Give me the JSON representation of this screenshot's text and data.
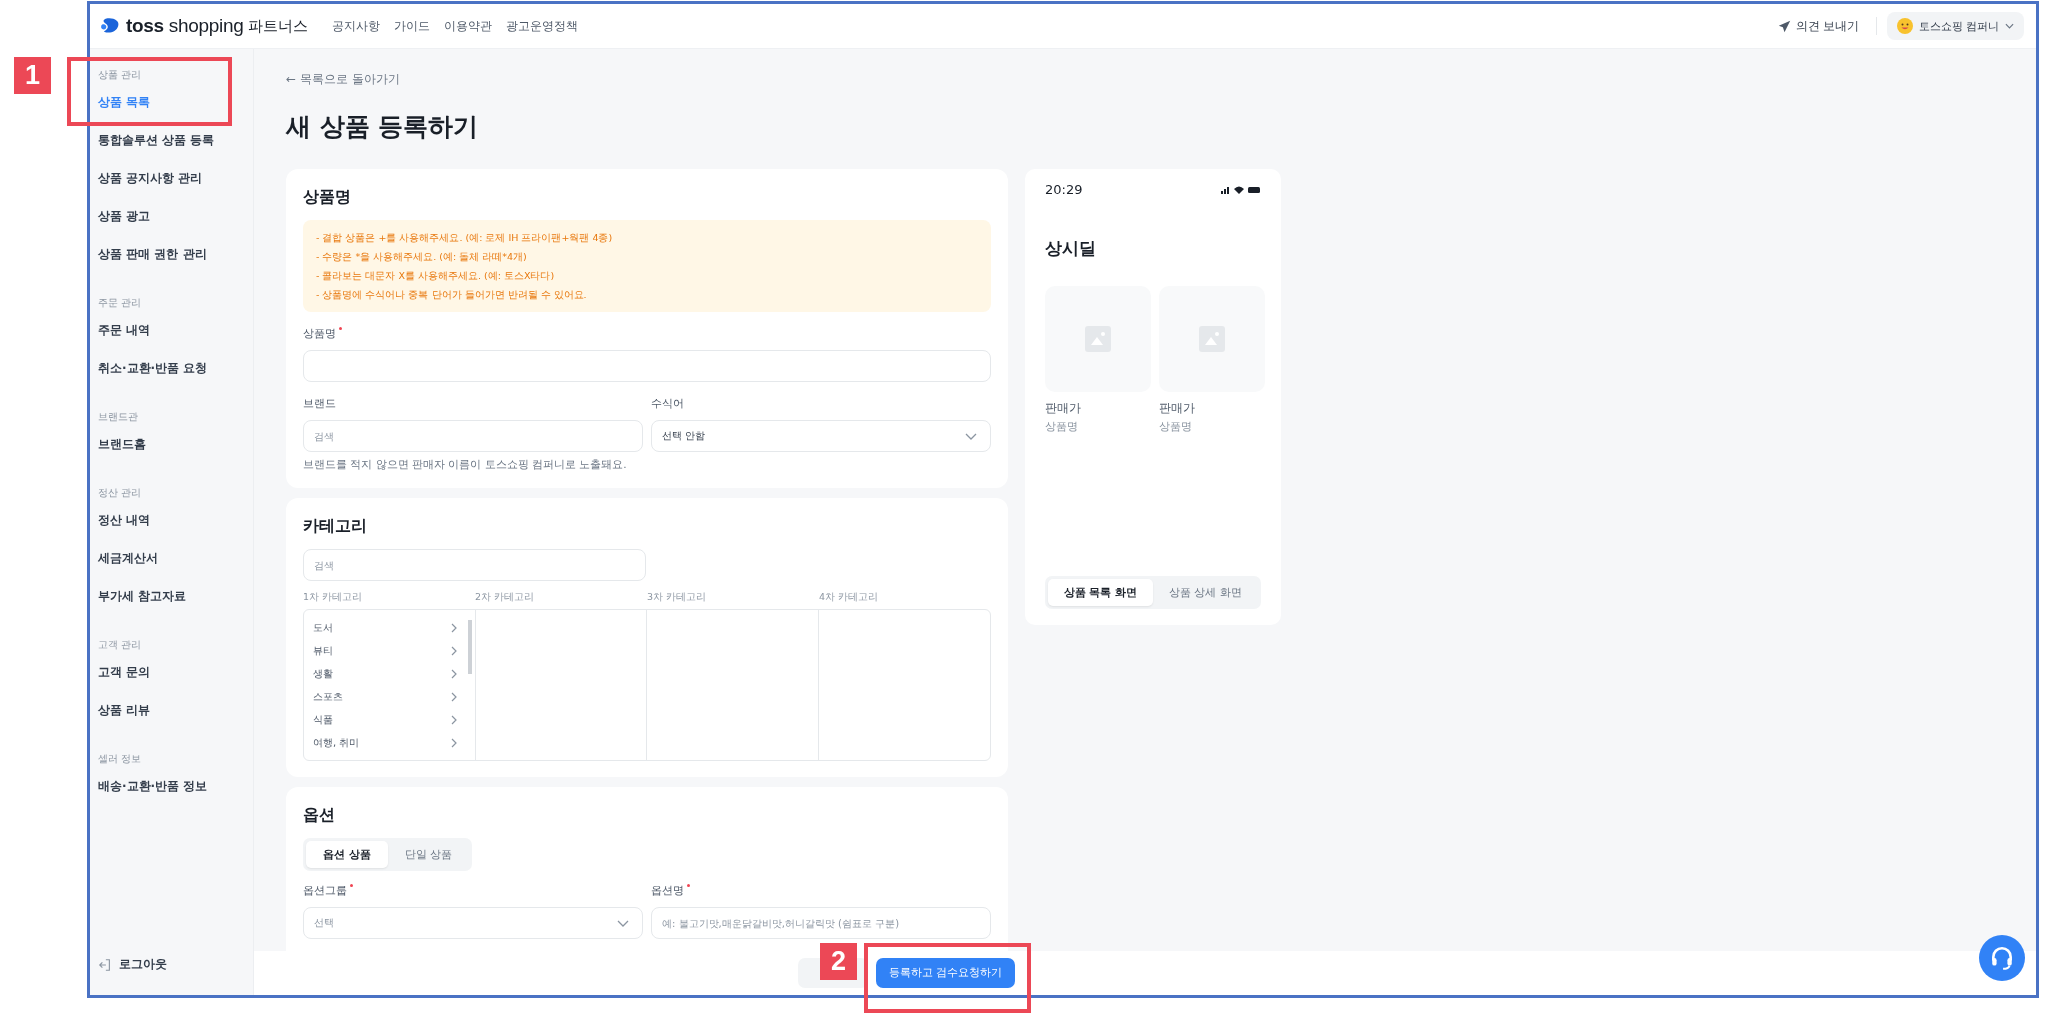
{
  "header": {
    "logo_word": "toss",
    "logo_rest": "shopping",
    "logo_suffix": "파트너스",
    "nav": [
      "공지사항",
      "가이드",
      "이용약관",
      "광고운영정책"
    ],
    "feedback": "의견 보내기",
    "account": "토스쇼핑 컴퍼니"
  },
  "sidebar": {
    "sections": [
      {
        "title": "상품 관리",
        "items": [
          {
            "label": "상품 목록",
            "selected": true
          },
          {
            "label": "통합솔루션 상품 등록",
            "selected": false
          },
          {
            "label": "상품 공지사항 관리",
            "selected": false
          },
          {
            "label": "상품 광고",
            "selected": false
          },
          {
            "label": "상품 판매 권한 관리",
            "selected": false
          }
        ]
      },
      {
        "title": "주문 관리",
        "items": [
          {
            "label": "주문 내역",
            "selected": false
          },
          {
            "label": "취소·교환·반품 요청",
            "selected": false
          }
        ]
      },
      {
        "title": "브랜드관",
        "items": [
          {
            "label": "브랜드홈",
            "selected": false
          }
        ]
      },
      {
        "title": "정산 관리",
        "items": [
          {
            "label": "정산 내역",
            "selected": false
          },
          {
            "label": "세금계산서",
            "selected": false
          },
          {
            "label": "부가세 참고자료",
            "selected": false
          }
        ]
      },
      {
        "title": "고객 관리",
        "items": [
          {
            "label": "고객 문의",
            "selected": false
          },
          {
            "label": "상품 리뷰",
            "selected": false
          }
        ]
      },
      {
        "title": "셀러 정보",
        "items": [
          {
            "label": "배송·교환·반품 정보",
            "selected": false
          }
        ]
      }
    ],
    "logout": "로그아웃"
  },
  "page": {
    "back_link": "← 목록으로 돌아가기",
    "title": "새 상품 등록하기"
  },
  "product_name": {
    "heading": "상품명",
    "notices": [
      "- 결합 상품은 +를 사용해주세요. (예: 로제 IH 프라이팬+웍팬 4종)",
      "- 수량은 *을 사용해주세요. (예: 돌체 라떼*4개)",
      "- 콜라보는 대문자 X를 사용해주세요. (예: 토스X타다)",
      "- 상품명에 수식어나 중복 단어가 들어가면 반려될 수 있어요."
    ],
    "name_label": "상품명",
    "brand_label": "브랜드",
    "brand_placeholder": "검색",
    "modifier_label": "수식어",
    "modifier_value": "선택 안함",
    "brand_hint": "브랜드를 적지 않으면 판매자 이름이 토스쇼핑 컴퍼니로 노출돼요."
  },
  "category": {
    "heading": "카테고리",
    "search_placeholder": "검색",
    "columns": [
      {
        "title": "1차 카테고리",
        "items": [
          "도서",
          "뷰티",
          "생활",
          "스포츠",
          "식품",
          "여행, 취미"
        ]
      },
      {
        "title": "2차 카테고리"
      },
      {
        "title": "3차 카테고리"
      },
      {
        "title": "4차 카테고리"
      }
    ]
  },
  "options": {
    "heading": "옵션",
    "tabs": [
      {
        "label": "옵션 상품",
        "selected": true
      },
      {
        "label": "단일 상품",
        "selected": false
      }
    ],
    "group_label": "옵션그룹",
    "group_placeholder": "선택",
    "name_label": "옵션명",
    "name_placeholder": "예: 불고기맛,매운닭갈비맛,허니갈릭맛 (쉼표로 구분)"
  },
  "footer": {
    "submit": "등록하고 검수요청하기"
  },
  "preview": {
    "time": "20:29",
    "title": "상시딜",
    "products": [
      {
        "price": "판매가",
        "name": "상품명"
      },
      {
        "price": "판매가",
        "name": "상품명"
      }
    ],
    "tabs": [
      {
        "label": "상품 목록 화면",
        "selected": true
      },
      {
        "label": "상품 상세 화면",
        "selected": false
      }
    ]
  },
  "annotations": [
    {
      "number": "1"
    },
    {
      "number": "2"
    }
  ]
}
